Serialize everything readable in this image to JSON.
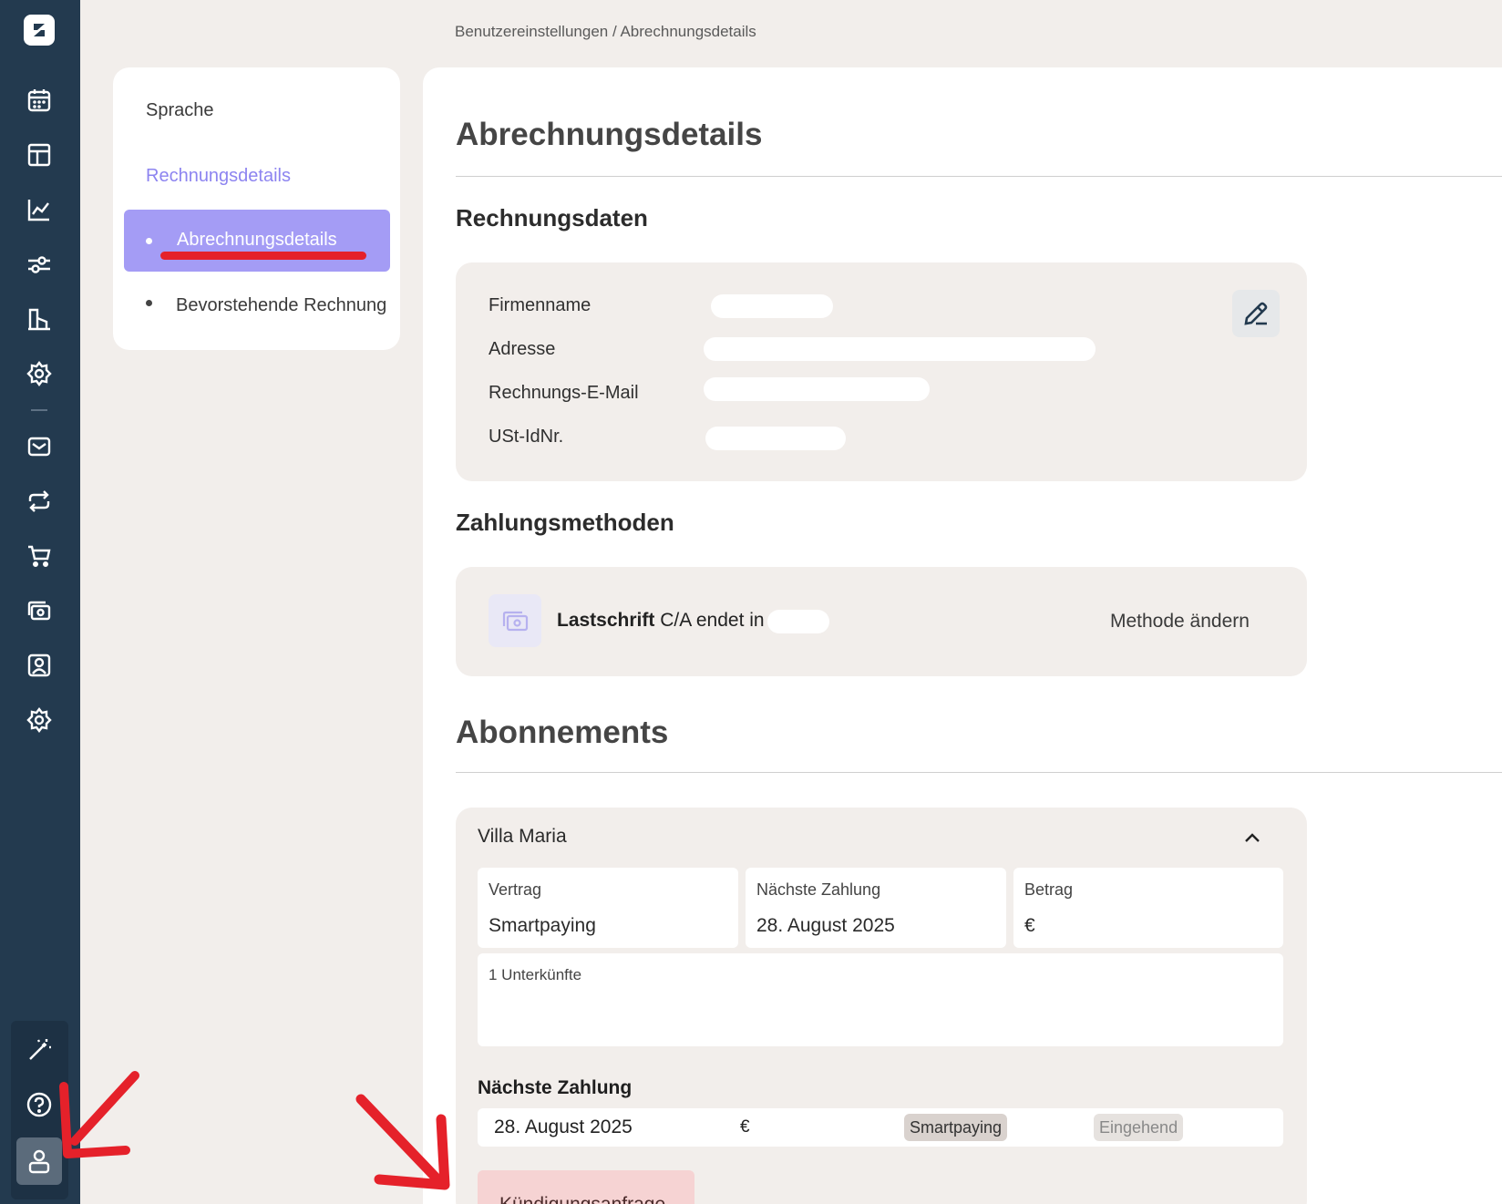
{
  "breadcrumb": "Benutzereinstellungen / Abrechnungsdetails",
  "subnav": {
    "language": "Sprache",
    "billing_details": "Rechnungsdetails",
    "active_item": "Abrechnungsdetails",
    "upcoming_item": "Bevorstehende Rechnung"
  },
  "page_title": "Abrechnungsdetails",
  "invoice_data": {
    "heading": "Rechnungsdaten",
    "labels": {
      "company": "Firmenname",
      "address": "Adresse",
      "email": "Rechnungs-E-Mail",
      "vat": "USt-IdNr."
    }
  },
  "payment_methods": {
    "heading": "Zahlungsmethoden",
    "method_bold": "Lastschrift",
    "method_rest": " C/A endet in",
    "change_label": "Methode ändern"
  },
  "subscriptions": {
    "heading": "Abonnements",
    "property_name": "Villa Maria",
    "contract_label": "Vertrag",
    "contract_value": "Smartpaying",
    "next_payment_label": "Nächste Zahlung",
    "next_payment_value": "28. August 2025",
    "amount_label": "Betrag",
    "amount_value": "€",
    "accommodations": "1 Unterkünfte",
    "next_payment_section": "Nächste Zahlung",
    "row": {
      "date": "28. August 2025",
      "amount": "€",
      "type_badge": "Smartpaying",
      "status_badge": "Eingehend"
    },
    "cancel_button": "Kündigungsanfrage"
  },
  "colors": {
    "rail": "#233a4f",
    "accent": "#a49cf5",
    "accent_text": "#8d84f0",
    "annotation_red": "#e5212a",
    "card_bg": "#f2eeeb"
  },
  "icons": [
    "logo-icon",
    "calendar-icon",
    "layout-icon",
    "chart-icon",
    "sliders-icon",
    "building-icon",
    "gear-icon",
    "mail-icon",
    "repeat-icon",
    "cart-icon",
    "money-icon",
    "contact-icon",
    "settings-icon",
    "magic-wand-icon",
    "help-icon",
    "user-icon",
    "edit-icon",
    "payment-icon",
    "chevron-up-icon"
  ]
}
